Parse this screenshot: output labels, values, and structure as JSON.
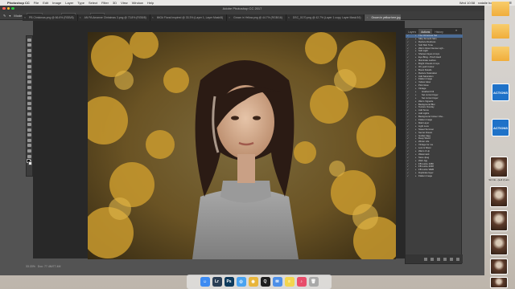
{
  "menubar": {
    "items": [
      "Photoshop CC",
      "File",
      "Edit",
      "Image",
      "Layer",
      "Type",
      "Select",
      "Filter",
      "3D",
      "View",
      "Window",
      "Help"
    ],
    "clock": "Wed 10:58",
    "user": "natalie houlding"
  },
  "window": {
    "title": "Adobe Photoshop CC 2017",
    "traffic_colors": [
      "#ff5f57",
      "#febc2e",
      "#28c840"
    ]
  },
  "options": {
    "mode_label": "Mode:",
    "mode_value": "Normal",
    "opacity_label": "Opacity:",
    "opacity_value": "100%",
    "flow_label": "Flow:",
    "flow_value": "100%"
  },
  "tabs": [
    {
      "label": "PB Christmas.png @ 66.6% (RGB/8)"
    },
    {
      "label": "AN PA Amanne Christmas 3.png @ 73.8% (RGB/8)"
    },
    {
      "label": "IMG# Floral Inspired @ 33.3% (Layer 1, Layer Mask/8)"
    },
    {
      "label": "Grown in Yellow.png @ 44.7% (RGB/16)"
    },
    {
      "label": "DSC_0170.png @ 42.7% (Layer 1 copy, Layer Mask/16)"
    },
    {
      "label": "Grown in yellow tree.jpg @ 33.7% (RGB/8)",
      "active": true
    }
  ],
  "status": {
    "zoom": "33.33%",
    "doc": "Doc: 77.4M/77.4M"
  },
  "panel": {
    "tabs": [
      "Layers",
      "Actions",
      "History"
    ],
    "active_tab": "Actions",
    "collapse": "»",
    "actions": [
      {
        "label": "The Christmas Set",
        "selected": true
      },
      {
        "label": "Silky Smooth Skin"
      },
      {
        "label": "Reduce Redness"
      },
      {
        "label": "Soft Skin Tone"
      },
      {
        "label": "Warm Glow Intense Ligh..."
      },
      {
        "label": "Soft Light"
      },
      {
        "label": "Sharpen Eyes & Lips"
      },
      {
        "label": "Eye Bling - Pinch Hard"
      },
      {
        "label": "Illuminate Lashes"
      },
      {
        "label": "Bright Cheeks & Lips"
      },
      {
        "label": "Oh yeah Colour"
      },
      {
        "label": "Boost Details"
      },
      {
        "label": "Reduce Saturation"
      },
      {
        "label": "Add Saturation"
      },
      {
        "label": "Flatten Image"
      },
      {
        "label": "Yellow Glow"
      },
      {
        "label": "Pink Glow"
      },
      {
        "label": "Vintage"
      },
      {
        "label": "Gradient Fill",
        "sub": true
      },
      {
        "label": "Set current layer",
        "sub": true
      },
      {
        "label": "Set current layer",
        "sub": true
      },
      {
        "label": "Warm Vignette"
      },
      {
        "label": "Background Blur"
      },
      {
        "label": "Texture Overlay"
      },
      {
        "label": "Add Snow"
      },
      {
        "label": "Add Lights"
      },
      {
        "label": "Background Colour Cha..."
      },
      {
        "label": "Flatten Image"
      },
      {
        "label": "Matt Layer"
      },
      {
        "label": "Light Love"
      },
      {
        "label": "Sweet Summer"
      },
      {
        "label": "Secret Dream"
      },
      {
        "label": "Golden Egg"
      },
      {
        "label": "Deep Wood"
      },
      {
        "label": "Winter Life"
      },
      {
        "label": "Vintage for me"
      },
      {
        "label": "Lost & Silver"
      },
      {
        "label": "Warm It Up"
      },
      {
        "label": "Watermark"
      },
      {
        "label": "Save Jpeg"
      },
      {
        "label": "Web Jpg"
      },
      {
        "label": "FB resize 1080"
      },
      {
        "label": "FB resize 2048"
      },
      {
        "label": "FB resize WEB"
      },
      {
        "label": "Duplicate layer"
      },
      {
        "label": "Flatten Image"
      }
    ]
  },
  "desktop": {
    "icons": [
      {
        "kind": "folder",
        "label": "",
        "color": "#f0ad3a"
      },
      {
        "kind": "folder",
        "label": "",
        "color": "#f0ad3a"
      },
      {
        "kind": "folder",
        "label": "",
        "color": "#f0ad3a"
      },
      {
        "kind": "actions",
        "label": "ACTIONS"
      },
      {
        "kind": "actions",
        "label": "ACTIONS"
      },
      {
        "kind": "thumb",
        "label": "Sit Clo...(sell 2).atn"
      },
      {
        "kind": "thumb",
        "label": ""
      },
      {
        "kind": "thumb",
        "label": ""
      },
      {
        "kind": "thumb",
        "label": ""
      },
      {
        "kind": "thumb",
        "label": ""
      },
      {
        "kind": "thumb",
        "label": ""
      }
    ]
  },
  "dock": {
    "apps": [
      {
        "name": "finder-icon",
        "glyph": "☺",
        "color": "#3d8bf2"
      },
      {
        "name": "lightroom-icon",
        "glyph": "Lr",
        "color": "#2a3e55"
      },
      {
        "name": "photoshop-icon",
        "glyph": "Ps",
        "color": "#0e3a5c"
      },
      {
        "name": "safari-icon",
        "glyph": "◎",
        "color": "#4aa3f0"
      },
      {
        "name": "chrome-icon",
        "glyph": "◉",
        "color": "#e8b53b"
      },
      {
        "name": "quicktime-icon",
        "glyph": "Q",
        "color": "#1f1f1f"
      },
      {
        "name": "mail-icon",
        "glyph": "✉",
        "color": "#4d8fe8"
      },
      {
        "name": "notes-icon",
        "glyph": "≡",
        "color": "#f3d54e"
      },
      {
        "name": "music-icon",
        "glyph": "♪",
        "color": "#e84d6b"
      },
      {
        "name": "trash-icon",
        "glyph": "🗑",
        "color": "#a9a9a9"
      }
    ]
  }
}
